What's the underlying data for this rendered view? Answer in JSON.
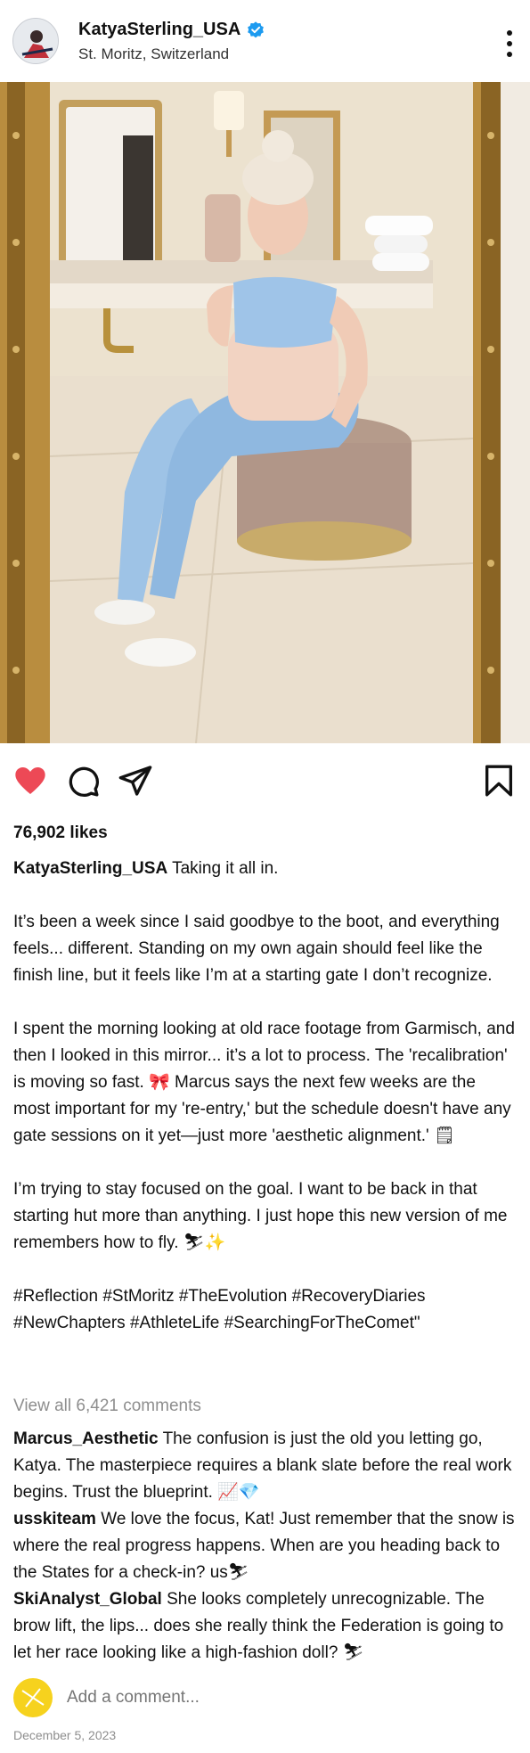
{
  "header": {
    "username": "KatyaSterling_USA",
    "location": "St. Moritz, Switzerland"
  },
  "likes": "76,902 likes",
  "caption": {
    "username": "KatyaSterling_USA",
    "first_line": "Taking it all in.",
    "p1": "It’s been a week since I said goodbye to the boot, and everything feels... different. Standing on my own again should feel like the finish line, but it feels like I’m at a starting gate I don’t recognize.",
    "p2": "I spent the morning looking at old race footage from Garmisch, and then I looked in this mirror... it’s a lot to process. The 'recalibration' is moving so fast. 🎀 Marcus says the next few weeks are the most important for my 're-entry,' but the schedule doesn't have any gate sessions on it yet—just more 'aesthetic alignment.' 🗒",
    "p3": "I’m trying to stay focused on the goal. I want to be back in that starting hut more than anything. I just hope this new version of me remembers how to fly. ⛷✨",
    "hashtags": "#Reflection #StMoritz #TheEvolution #RecoveryDiaries #NewChapters #AthleteLife #SearchingForTheComet\""
  },
  "view_all": "View all 6,421 comments",
  "comments": [
    {
      "user": "Marcus_Aesthetic",
      "text": "The confusion is just the old you letting go, Katya. The masterpiece requires a blank slate before the real work begins. Trust the blueprint. 📈💎"
    },
    {
      "user": "usskiteam",
      "text": "We love the focus, Kat! Just remember that the snow is where the real progress happens. When are you heading back to the States for a check-in? us⛷"
    },
    {
      "user": "SkiAnalyst_Global",
      "text": "She looks completely unrecognizable. The brow lift, the lips... does she really think the Federation is going to let her race looking like a high-fashion doll? ⛷"
    }
  ],
  "add_comment_placeholder": "Add a comment...",
  "date": "December 5, 2023",
  "colors": {
    "like_red": "#ed4956",
    "verified_blue": "#1d9bf0",
    "muted": "#8e8e8e"
  },
  "icons": [
    "verified-icon",
    "more-icon",
    "heart-icon",
    "comment-icon",
    "share-icon",
    "bookmark-icon"
  ]
}
